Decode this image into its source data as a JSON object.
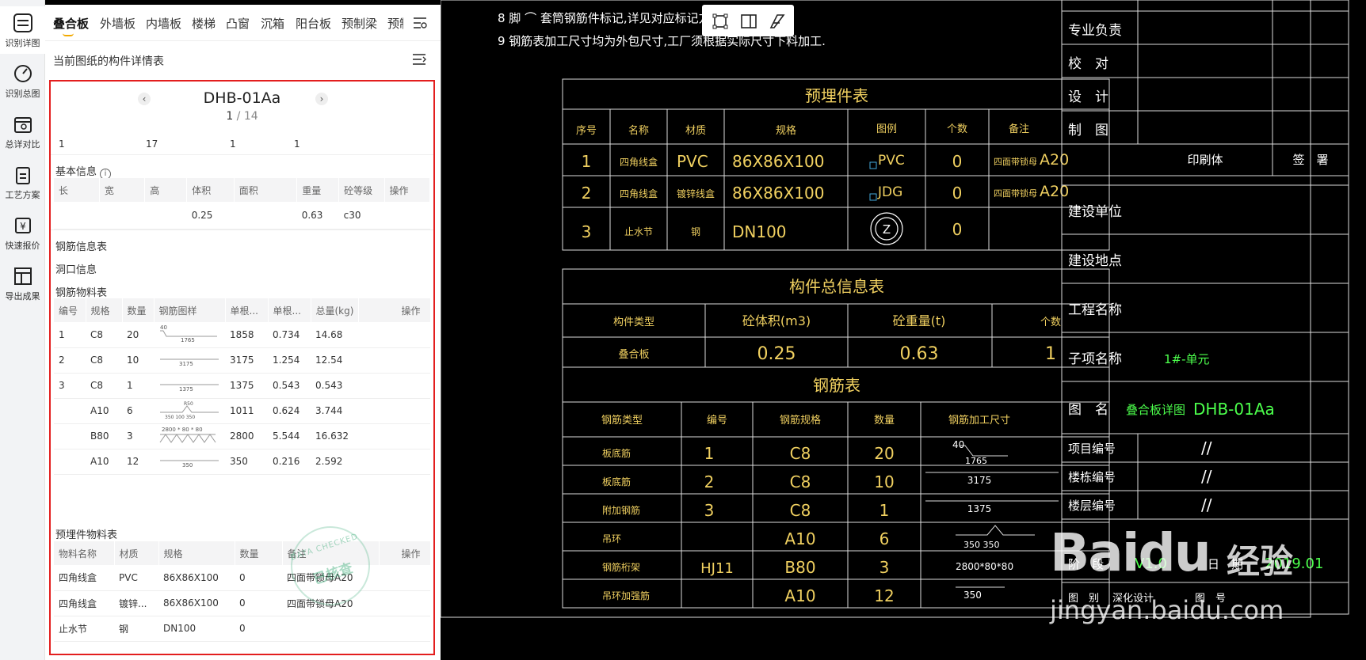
{
  "rail": [
    {
      "label": "识别详图",
      "icon": "layers-icon"
    },
    {
      "label": "识别总图",
      "icon": "gauge-icon"
    },
    {
      "label": "总详对比",
      "icon": "calendar-search-icon"
    },
    {
      "label": "工艺方案",
      "icon": "clipboard-icon"
    },
    {
      "label": "快速报价",
      "icon": "price-icon"
    },
    {
      "label": "导出成果",
      "icon": "export-table-icon"
    }
  ],
  "tabs": [
    "叠合板",
    "外墙板",
    "内墙板",
    "楼梯",
    "凸窗",
    "沉箱",
    "阳台板",
    "预制梁",
    "预制"
  ],
  "panel_title": "当前图纸的构件详情表",
  "component": {
    "name": "DHB-01Aa",
    "current": "1",
    "separator": " / ",
    "total": "14",
    "summary": [
      "1",
      "17",
      "1",
      "1"
    ]
  },
  "basic_info": {
    "title": "基本信息",
    "info_glyph": "i",
    "headers": [
      "长",
      "宽",
      "高",
      "体积",
      "面积",
      "重量",
      "砼等级",
      "操作"
    ],
    "row": [
      "",
      "",
      "",
      "0.25",
      "",
      "0.63",
      "c30",
      ""
    ]
  },
  "rebar_info_title": "钢筋信息表",
  "opening_title": "洞口信息",
  "rebar_material": {
    "title": "钢筋物料表",
    "headers": [
      "编号",
      "规格",
      "数量",
      "钢筋图样",
      "单根...",
      "单根...",
      "总量(kg)",
      "操作"
    ],
    "rows": [
      [
        "1",
        "C8",
        "20",
        "",
        "1858",
        "0.734",
        "14.68",
        ""
      ],
      [
        "2",
        "C8",
        "10",
        "",
        "3175",
        "1.254",
        "12.54",
        ""
      ],
      [
        "3",
        "C8",
        "1",
        "",
        "1375",
        "0.543",
        "0.543",
        ""
      ],
      [
        "",
        "A10",
        "6",
        "",
        "1011",
        "0.624",
        "3.744",
        ""
      ],
      [
        "",
        "B80",
        "3",
        "",
        "2800",
        "5.544",
        "16.632",
        ""
      ],
      [
        "",
        "A10",
        "12",
        "",
        "350",
        "0.216",
        "2.592",
        ""
      ]
    ],
    "figs": [
      {
        "top": "40",
        "bottom": "1765"
      },
      {
        "top": "",
        "bottom": "3175"
      },
      {
        "top": "",
        "bottom": "1375"
      },
      {
        "top": "R50",
        "bottom": "350  100  350"
      },
      {
        "top": "2800 * 80 * 80",
        "bottom": ""
      },
      {
        "top": "",
        "bottom": "350"
      }
    ]
  },
  "embedded_material": {
    "title": "预埋件物料表",
    "headers": [
      "物料名称",
      "材质",
      "规格",
      "数量",
      "备注",
      "操作"
    ],
    "rows": [
      [
        "四角线盒",
        "PVC",
        "86X86X100",
        "0",
        "四面带锁母A20",
        ""
      ],
      [
        "四角线盒",
        "镀锌...",
        "86X86X100",
        "0",
        "四面带锁母A20",
        ""
      ],
      [
        "止水节",
        "钢",
        "DN100",
        "0",
        "",
        ""
      ]
    ]
  },
  "stamp": {
    "ring": "DATA CHECKED",
    "text": "已核查"
  },
  "drawing": {
    "notes": [
      "8 脚  ⌒ 套筒钢筋件标记,详见对应标记方向安装",
      "9 钢筋表加工尺寸均为外包尺寸,工厂须根据实际尺寸下料加工."
    ],
    "embedded_table": {
      "title": "预埋件表",
      "headers": [
        "序号",
        "名称",
        "材质",
        "规格",
        "图例",
        "个数",
        "备注"
      ],
      "rows": [
        [
          "1",
          "四角线盒",
          "PVC",
          "86X86X100",
          "PVC",
          "0",
          "四面带锁母",
          "A20"
        ],
        [
          "2",
          "四角线盒",
          "镀锌线盒",
          "86X86X100",
          "JDG",
          "0",
          "四面带锁母",
          "A20"
        ],
        [
          "3",
          "止水节",
          "钢",
          "DN100",
          "Z",
          "0",
          "",
          ""
        ]
      ]
    },
    "summary_table": {
      "title": "构件总信息表",
      "headers": [
        "构件类型",
        "砼体积(m3)",
        "砼重量(t)",
        "个数"
      ],
      "row": [
        "叠合板",
        "0.25",
        "0.63",
        "1"
      ]
    },
    "rebar_table": {
      "title": "钢筋表",
      "headers": [
        "钢筋类型",
        "编号",
        "钢筋规格",
        "数量",
        "钢筋加工尺寸"
      ],
      "rows": [
        [
          "板底筋",
          "1",
          "C8",
          "20",
          "1765"
        ],
        [
          "板底筋",
          "2",
          "C8",
          "10",
          "3175"
        ],
        [
          "附加钢筋",
          "3",
          "C8",
          "1",
          "1375"
        ],
        [
          "吊环",
          "",
          "A10",
          "6",
          "350  350"
        ],
        [
          "钢筋桁架",
          "HJ11",
          "B80",
          "3",
          "2800*80*80"
        ],
        [
          "吊环加强筋",
          "",
          "A10",
          "12",
          "350"
        ]
      ]
    },
    "title_block": {
      "top_rows": [
        "专业负责",
        "校　对",
        "设　计",
        "制　图"
      ],
      "print_label": "印刷体",
      "sign_label": "签　署",
      "project_rows": [
        "建设单位",
        "建设地点",
        "工程名称"
      ],
      "sub_label": "子项名称",
      "sub_value": "1#-单元",
      "fig_label": "图　名",
      "fig_value": "叠合板详图",
      "fig_code": "DHB-01Aa",
      "code_rows": [
        [
          "项目编号",
          "//"
        ],
        [
          "楼栋编号",
          "//"
        ],
        [
          "楼层编号",
          "//"
        ]
      ],
      "phase_label": "阶　段",
      "phase_value": "V1.0",
      "date_label": "日　期",
      "date_value": "2019.01",
      "bottom_row": [
        "图　别",
        "深化设计",
        "图　号"
      ]
    }
  },
  "watermark": {
    "logo": "Baidu",
    "cn": "经验",
    "url": "jingyan.baidu.com"
  }
}
